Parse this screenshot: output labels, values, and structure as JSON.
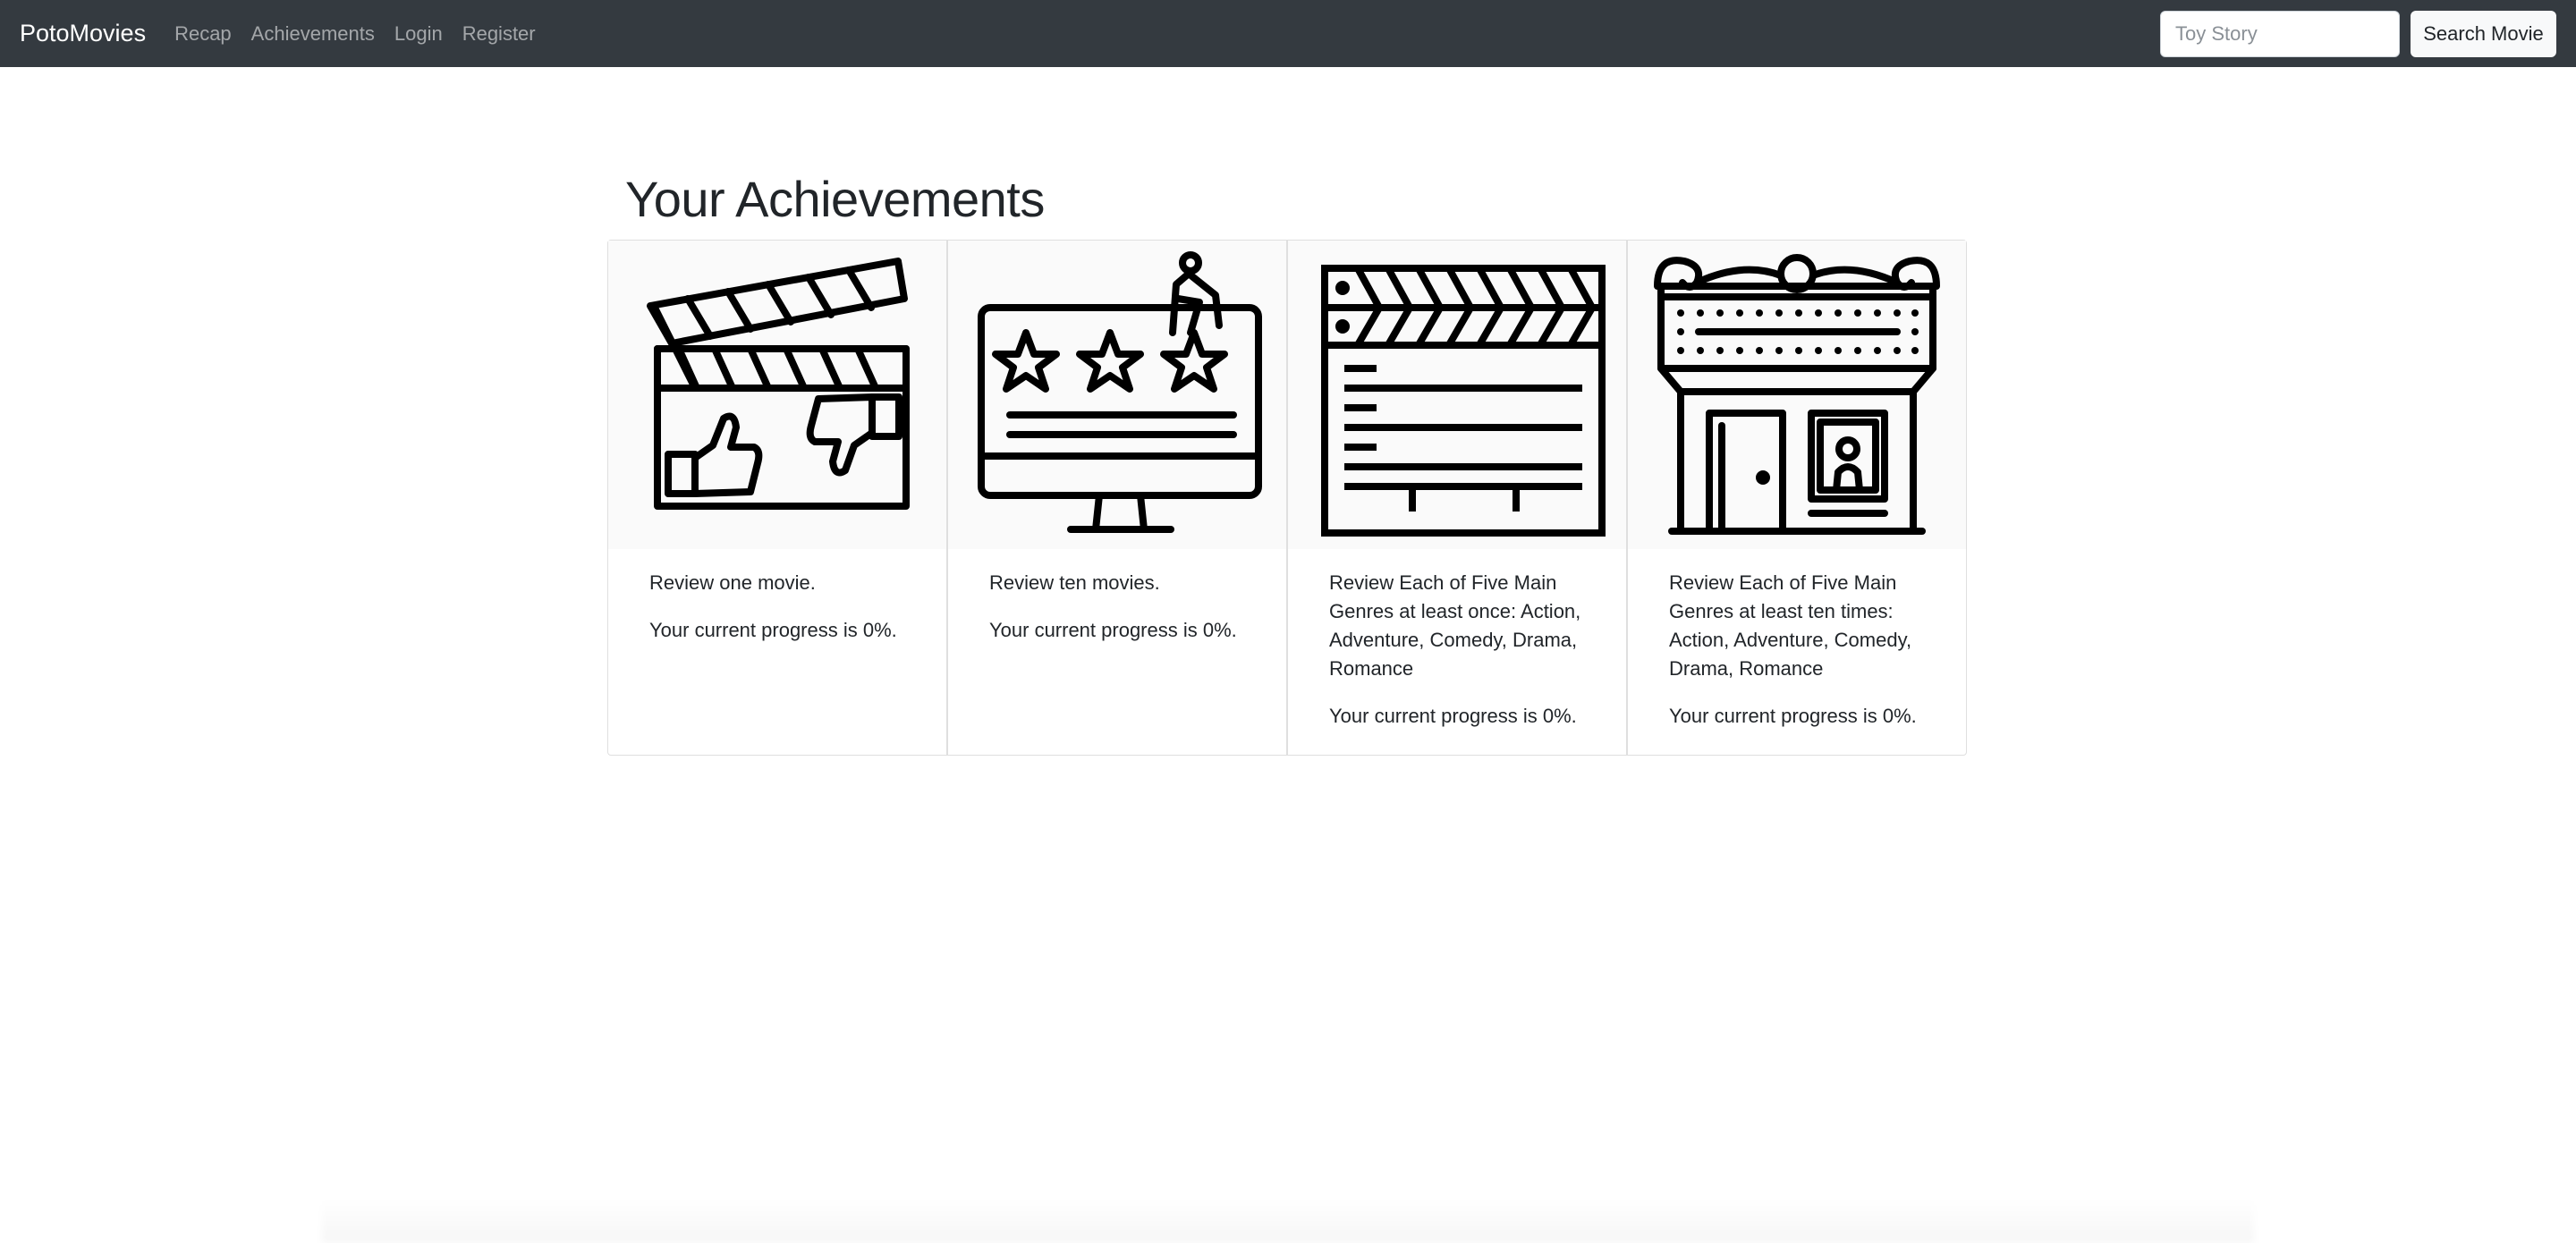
{
  "navbar": {
    "brand": "PotoMovies",
    "links": [
      {
        "label": "Recap"
      },
      {
        "label": "Achievements"
      },
      {
        "label": "Login"
      },
      {
        "label": "Register"
      }
    ],
    "search": {
      "placeholder": "Toy Story",
      "button_label": "Search Movie"
    }
  },
  "main": {
    "title": "Your Achievements",
    "cards": [
      {
        "icon": "clapperboard-thumbs-icon",
        "title": "Review one movie.",
        "progress": "Your current progress is 0%."
      },
      {
        "icon": "monitor-stars-review-icon",
        "title": "Review ten movies.",
        "progress": "Your current progress is 0%."
      },
      {
        "icon": "clapperboard-list-icon",
        "title": "Review Each of Five Main Genres at least once: Action, Adventure, Comedy, Drama, Romance",
        "progress": "Your current progress is 0%."
      },
      {
        "icon": "cinema-building-icon",
        "title": "Review Each of Five Main Genres at least ten times: Action, Adventure, Comedy, Drama, Romance",
        "progress": "Your current progress is 0%."
      }
    ]
  },
  "colors": {
    "navbar_bg": "#343a40",
    "nav_link": "#9a9da0",
    "text": "#212529",
    "card_border": "#dfdfdf"
  }
}
